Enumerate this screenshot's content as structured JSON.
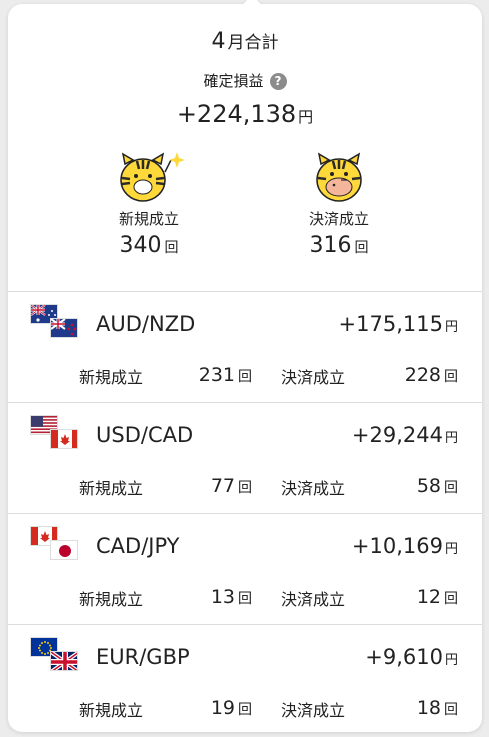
{
  "summary": {
    "month_number": "4",
    "month_label": "月合計",
    "pl_label": "確定損益",
    "help_icon": "?",
    "pl_value": "+224,138",
    "pl_unit": "円",
    "new_label": "新規成立",
    "new_count": "340",
    "close_label": "決済成立",
    "close_count": "316",
    "count_unit": "回"
  },
  "colors": {
    "mascot_yellow": "#ffd83a",
    "mascot_stripe": "#2b2b2b",
    "divider": "#dcdcdc"
  },
  "pairs": [
    {
      "name": "AUD/NZD",
      "pl": "+175,115",
      "unit": "円",
      "new_label": "新規成立",
      "new_count": "231",
      "close_label": "決済成立",
      "close_count": "228",
      "count_unit": "回",
      "flags": [
        "australia-flag",
        "new-zealand-flag"
      ]
    },
    {
      "name": "USD/CAD",
      "pl": "+29,244",
      "unit": "円",
      "new_label": "新規成立",
      "new_count": "77",
      "close_label": "決済成立",
      "close_count": "58",
      "count_unit": "回",
      "flags": [
        "usa-flag",
        "canada-flag"
      ]
    },
    {
      "name": "CAD/JPY",
      "pl": "+10,169",
      "unit": "円",
      "new_label": "新規成立",
      "new_count": "13",
      "close_label": "決済成立",
      "close_count": "12",
      "count_unit": "回",
      "flags": [
        "canada-flag",
        "japan-flag"
      ]
    },
    {
      "name": "EUR/GBP",
      "pl": "+9,610",
      "unit": "円",
      "new_label": "新規成立",
      "new_count": "19",
      "close_label": "決済成立",
      "close_count": "18",
      "count_unit": "回",
      "flags": [
        "eu-flag",
        "uk-flag"
      ]
    }
  ]
}
